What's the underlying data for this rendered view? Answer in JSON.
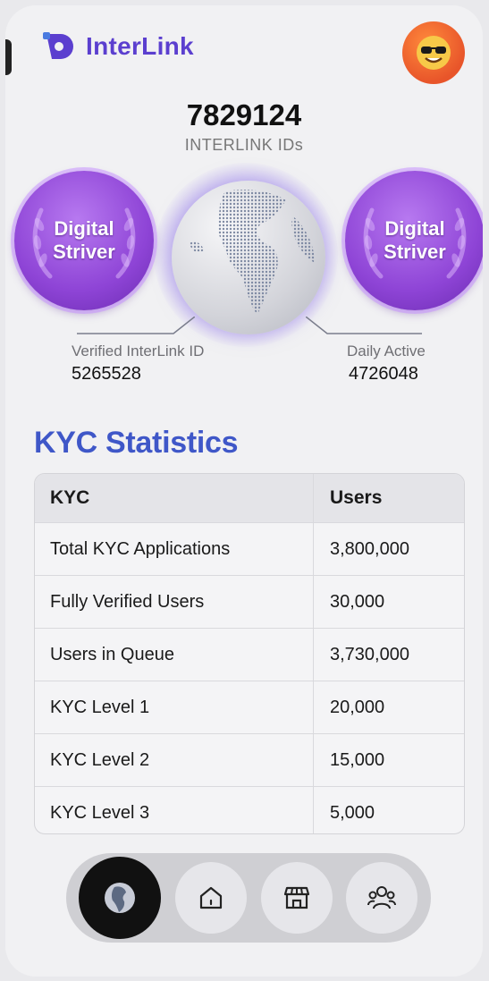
{
  "app": {
    "name": "InterLink"
  },
  "header": {
    "avatar_icon": "sunglasses-emoji-icon"
  },
  "totals": {
    "value": "7829124",
    "label": "INTERLINK IDs"
  },
  "badges": [
    {
      "line1": "Digital",
      "line2": "Striver"
    },
    {
      "line1": "Digital",
      "line2": "Striver"
    }
  ],
  "metrics": {
    "verified": {
      "label": "Verified InterLink ID",
      "value": "5265528"
    },
    "daily": {
      "label": "Daily Active",
      "value": "4726048"
    }
  },
  "kyc": {
    "title": "KYC Statistics",
    "columns": [
      "KYC",
      "Users"
    ],
    "rows": [
      [
        "Total KYC Applications",
        "3,800,000"
      ],
      [
        "Fully Verified Users",
        "30,000"
      ],
      [
        "Users in Queue",
        "3,730,000"
      ],
      [
        "KYC Level 1",
        "20,000"
      ],
      [
        "KYC Level 2",
        "15,000"
      ],
      [
        "KYC Level 3",
        "5,000"
      ]
    ]
  },
  "nav": {
    "items": [
      {
        "icon": "globe-icon",
        "active": true
      },
      {
        "icon": "home-icon",
        "active": false
      },
      {
        "icon": "store-icon",
        "active": false
      },
      {
        "icon": "people-icon",
        "active": false
      }
    ]
  },
  "colors": {
    "brand": "#5b3fcf",
    "heading": "#3f57c8",
    "badge": "#8e44d6",
    "avatar": "#e8552a"
  }
}
